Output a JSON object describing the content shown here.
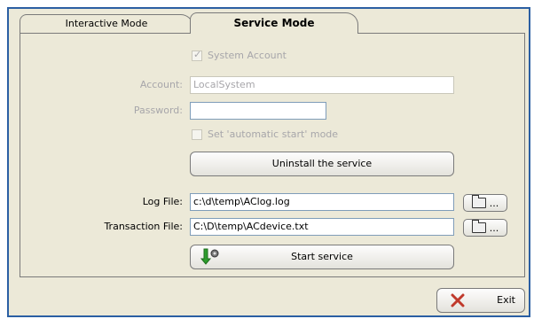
{
  "tabs": {
    "interactive": "Interactive Mode",
    "service": "Service Mode"
  },
  "service": {
    "system_account_label": "System Account",
    "account_label": "Account:",
    "account_value": "LocalSystem",
    "password_label": "Password:",
    "password_value": "",
    "auto_start_label": "Set 'automatic start' mode",
    "uninstall_label": "Uninstall the service",
    "log_file_label": "Log File:",
    "log_file_value": "c:\\d\\temp\\AClog.log",
    "transaction_file_label": "Transaction File:",
    "transaction_file_value": "C:\\D\\temp\\ACdevice.txt",
    "browse_label": "...",
    "start_service_label": "Start service"
  },
  "footer": {
    "exit_label": "Exit"
  },
  "icons": [
    "checkbox-tick-icon",
    "folder-icon",
    "start-service-icon",
    "exit-x-icon"
  ],
  "colors": {
    "frame_border": "#2b5fa3",
    "background": "#ece9d8",
    "disabled_text": "#a7a6aa",
    "exit_icon": "#c0392b"
  }
}
